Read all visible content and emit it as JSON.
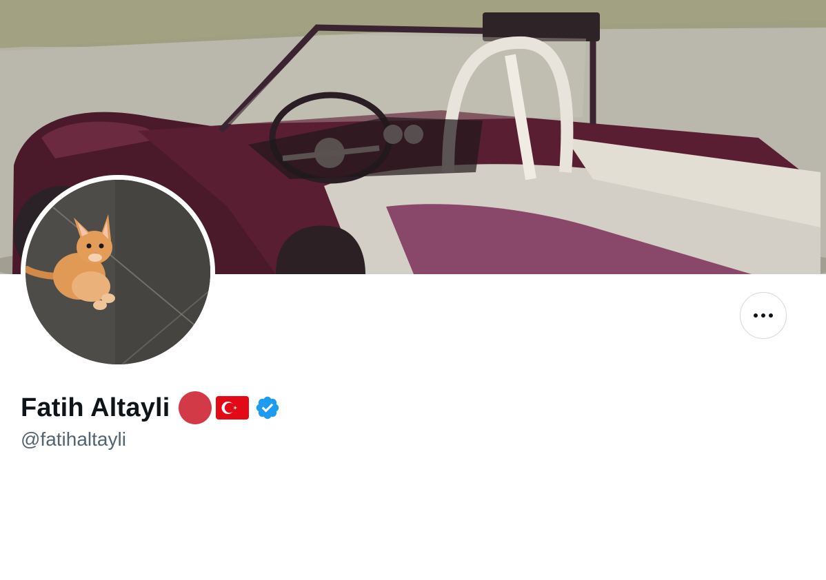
{
  "profile": {
    "display_name": "Fatih Altayli",
    "handle": "@fatihaltayli",
    "badges": [
      "red-circle-emoji",
      "turkey-flag-emoji",
      "verified-badge-icon"
    ]
  },
  "banner": {
    "subject": "vintage roadster car image"
  },
  "avatar": {
    "subject": "kitten photo"
  },
  "actions": {
    "more_icon": "more-horizontal-icon"
  },
  "colors": {
    "name_text": "#0f1419",
    "handle_text": "#536471",
    "verified_blue": "#1d9bf0",
    "red_circle": "#d33a47",
    "flag_red": "#e30a17",
    "button_border": "#cfd9de"
  }
}
